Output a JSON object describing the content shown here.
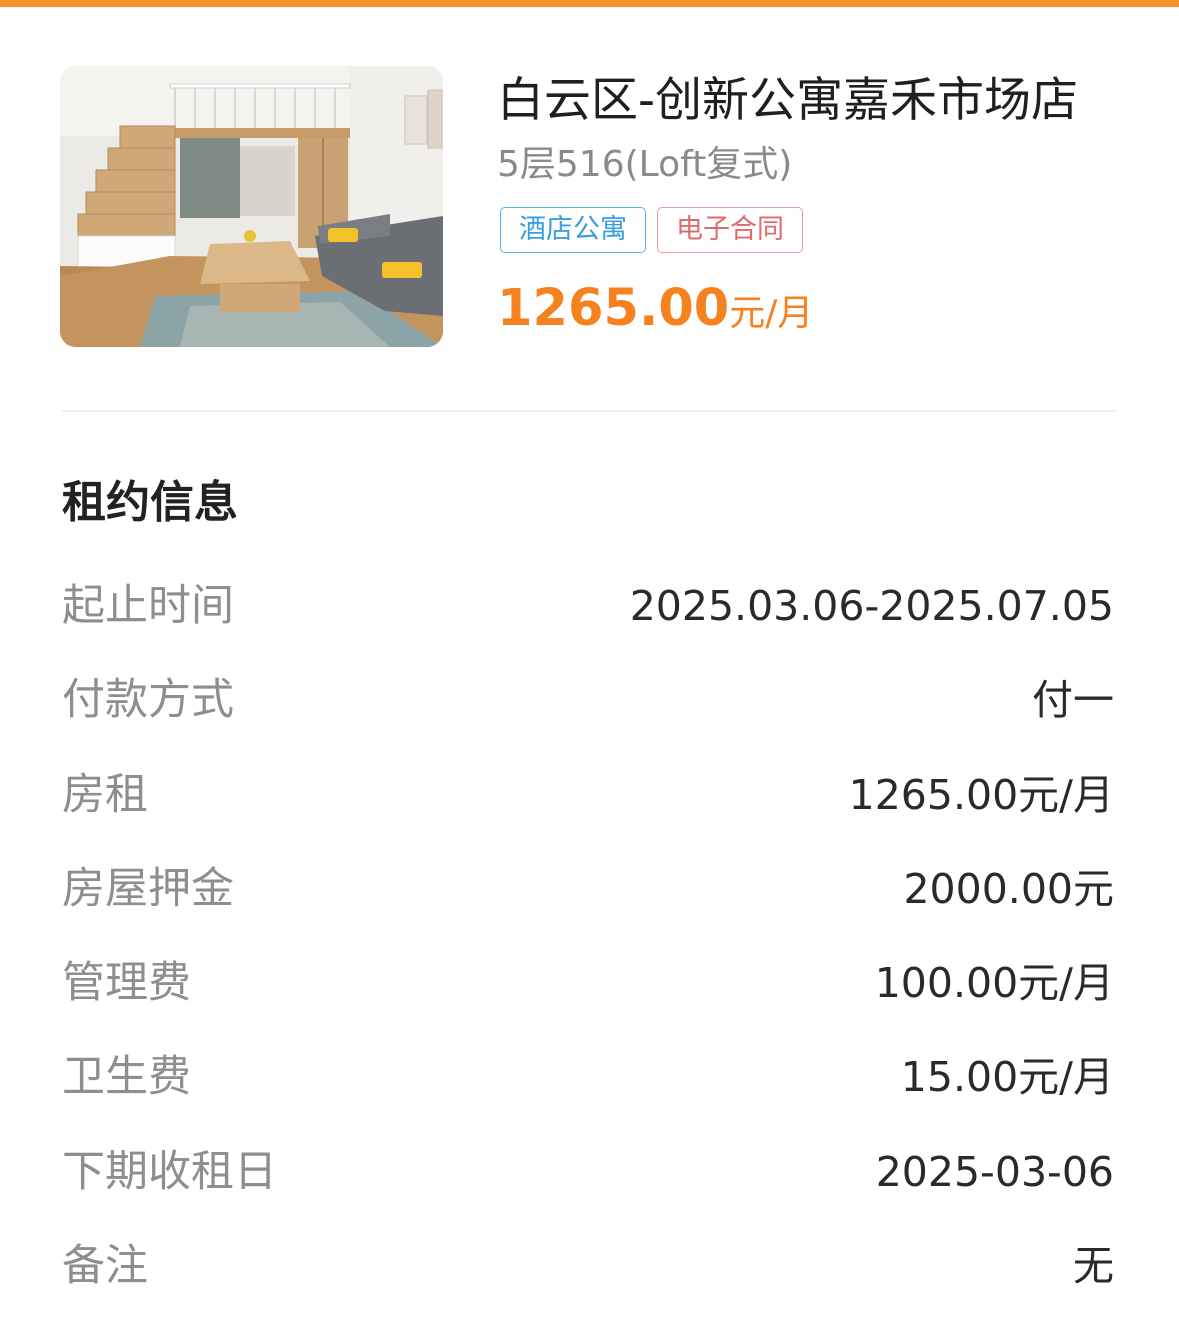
{
  "accent_color": "#f7922e",
  "listing": {
    "title": "白云区-创新公寓嘉禾市场店",
    "subtitle": "5层516(Loft复式)",
    "tags": [
      "酒店公寓",
      "电子合同"
    ],
    "price": "1265.00",
    "price_unit": "元/月"
  },
  "lease": {
    "section_title": "租约信息",
    "rows": [
      {
        "label": "起止时间",
        "value": "2025.03.06-2025.07.05"
      },
      {
        "label": "付款方式",
        "value": "付一"
      },
      {
        "label": "房租",
        "value": "1265.00元/月"
      },
      {
        "label": "房屋押金",
        "value": "2000.00元"
      },
      {
        "label": "管理费",
        "value": "100.00元/月"
      },
      {
        "label": "卫生费",
        "value": "15.00元/月"
      },
      {
        "label": "下期收租日",
        "value": "2025-03-06"
      },
      {
        "label": "备注",
        "value": "无"
      }
    ]
  }
}
